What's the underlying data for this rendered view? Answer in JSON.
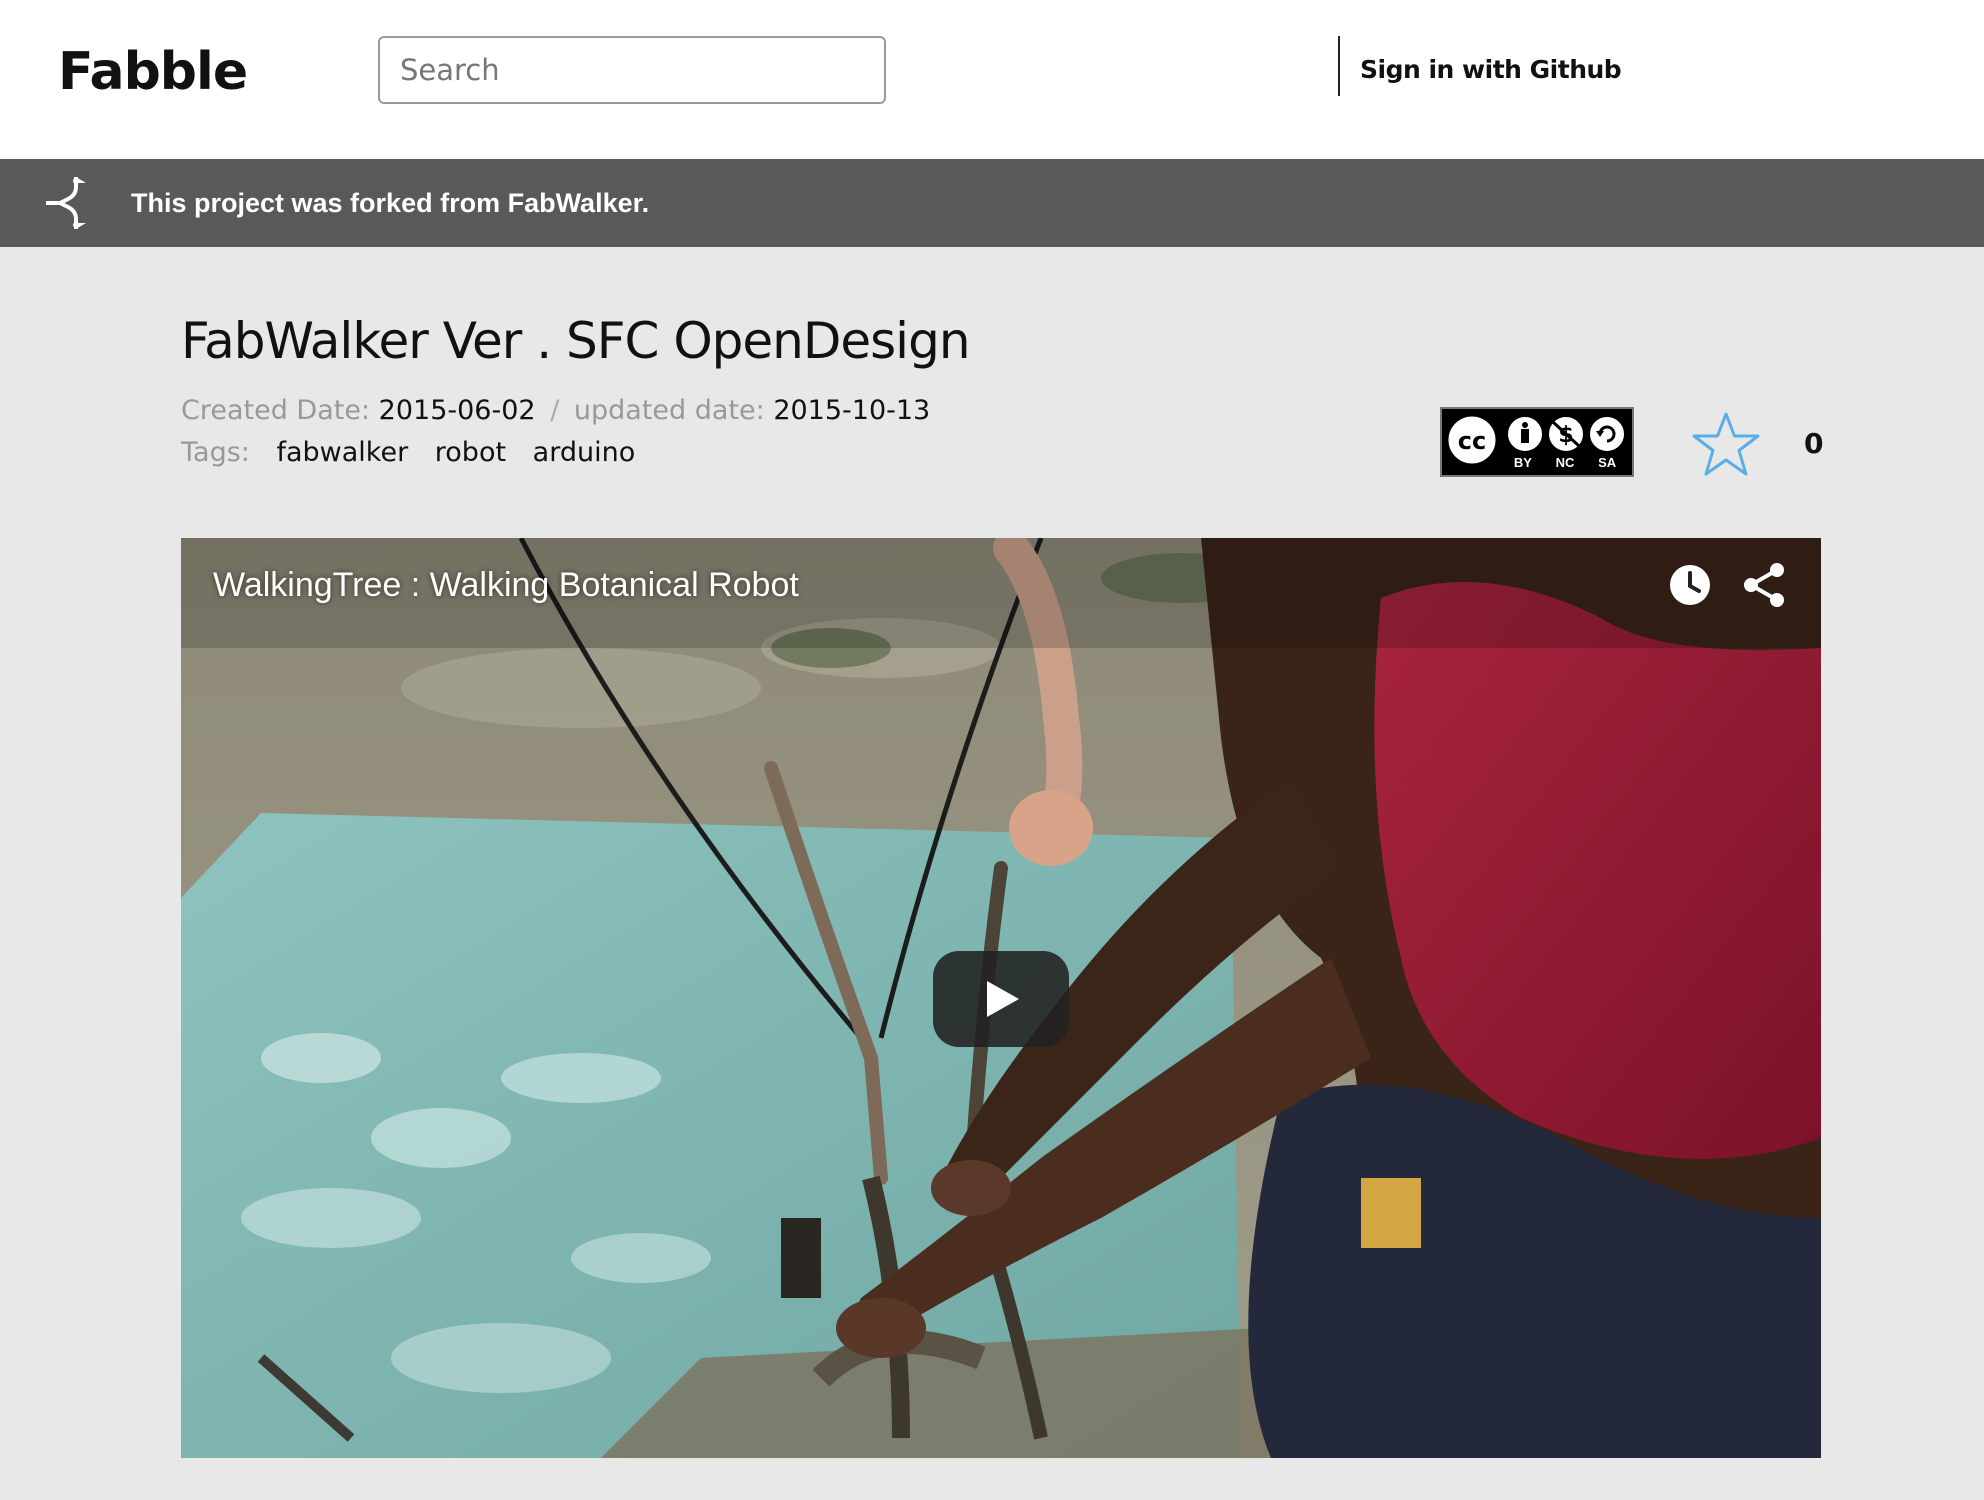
{
  "header": {
    "logo": "Fabble",
    "search_placeholder": "Search",
    "signin_label": "Sign in with Github"
  },
  "banner": {
    "text": "This project was forked from FabWalker.",
    "icon": "fork-icon"
  },
  "project": {
    "title": "FabWalker Ver . SFC OpenDesign",
    "created_label": "Created Date:",
    "created_value": "2015-06-02",
    "separator": "/",
    "updated_label": "updated date:",
    "updated_value": "2015-10-13",
    "tags_label": "Tags:",
    "tags": [
      "fabwalker",
      "robot",
      "arduino"
    ],
    "license": {
      "icon": "cc-by-nc-sa-icon",
      "labels": [
        "BY",
        "NC",
        "SA"
      ]
    },
    "star_icon": "star-icon",
    "star_count": "0"
  },
  "video": {
    "title": "WalkingTree : Walking Botanical Robot",
    "icons": [
      "clock-icon",
      "share-icon",
      "play-icon"
    ]
  },
  "colors": {
    "banner_bg": "#595959",
    "page_bg": "#e8e8e8",
    "star_outline": "#5aaee8"
  }
}
